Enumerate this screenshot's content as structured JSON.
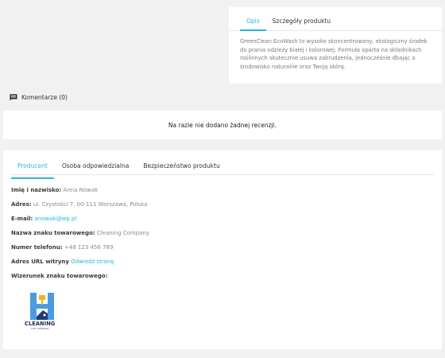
{
  "description_card": {
    "tabs": [
      {
        "label": "Opis",
        "active": true
      },
      {
        "label": "Szczegóły produktu",
        "active": false
      }
    ],
    "text": "GreenClean EcoWash to wysoko skoncentrowany, ekologiczny środek do prania odzieży białej i kolorowej. Formuła oparta na składnikach roślinnych skutecznie usuwa zabrudzenia, jednocześnie dbając o środowisko naturalne oraz Twoją skórę."
  },
  "comments": {
    "heading": "Komentarze (0)",
    "empty_message": "Na razie nie dodano żadnej recenzji."
  },
  "producer_card": {
    "tabs": [
      {
        "label": "Producent",
        "active": true
      },
      {
        "label": "Osoba odpowiedzialna",
        "active": false
      },
      {
        "label": "Bezpieczeństwo produktu",
        "active": false
      }
    ],
    "name_label": "Imię i nazwisko:",
    "name_value": "Anna Nowak",
    "address_label": "Adres:",
    "address_value": "ul. Czystości 7, 00-111 Warszawa, Polska",
    "email_label": "E-mail:",
    "email_value": "anowak@wp.pl",
    "brand_label": "Nazwa znaku towarowego:",
    "brand_value": "Cleaning Company",
    "phone_label": "Numer telefonu:",
    "phone_value": "+48 123 456 789",
    "url_label": "Adres URL witryny",
    "url_value": "Odwiedź stronę",
    "logo_label": "Wizerunek znaku towarowego:",
    "logo_text": "CLEANING",
    "logo_subtext": "THE COMPANY"
  },
  "colors": {
    "accent": "#25b9d7",
    "background": "#f1f1f1",
    "card": "#ffffff"
  },
  "icons": {
    "comments": "comment-icon"
  }
}
